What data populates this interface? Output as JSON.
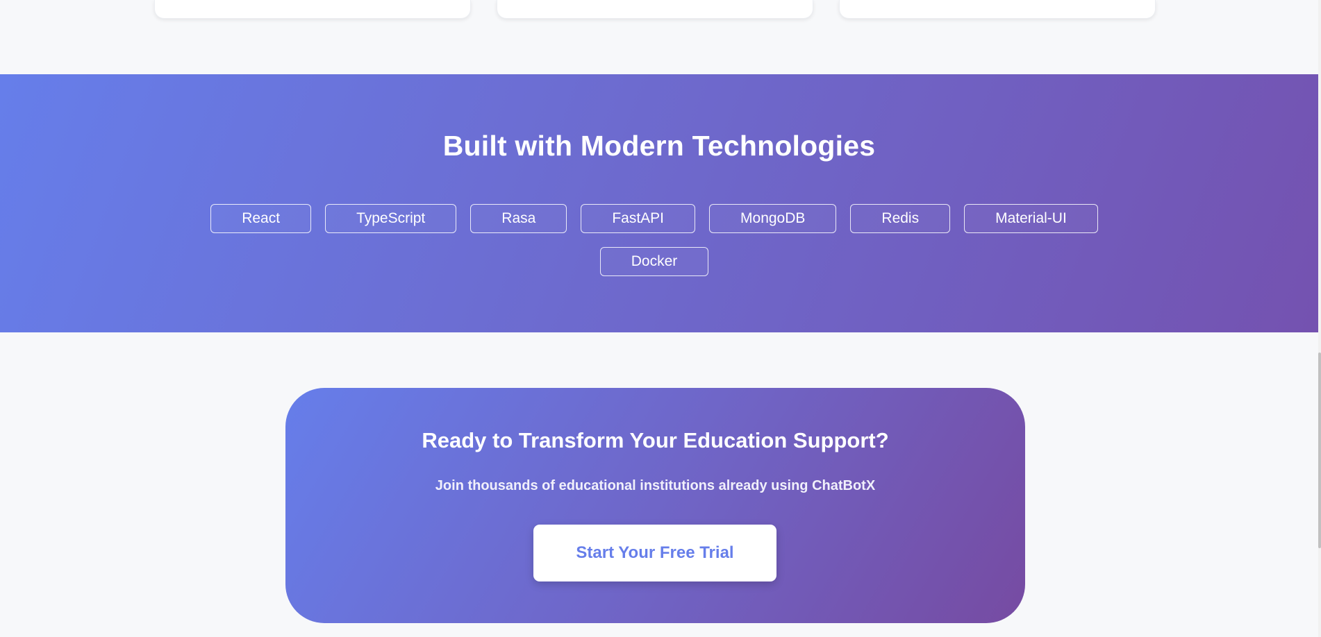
{
  "tech_section": {
    "title": "Built with Modern Technologies",
    "technologies": [
      "React",
      "TypeScript",
      "Rasa",
      "FastAPI",
      "MongoDB",
      "Redis",
      "Material-UI",
      "Docker"
    ]
  },
  "cta": {
    "title": "Ready to Transform Your Education Support?",
    "subtitle": "Join thousands of educational institutions already using ChatBotX",
    "button_label": "Start Your Free Trial"
  },
  "colors": {
    "gradient_start": "#667eea",
    "gradient_end": "#764ba2",
    "page_background": "#f7f8fa",
    "button_text": "#667eea"
  }
}
